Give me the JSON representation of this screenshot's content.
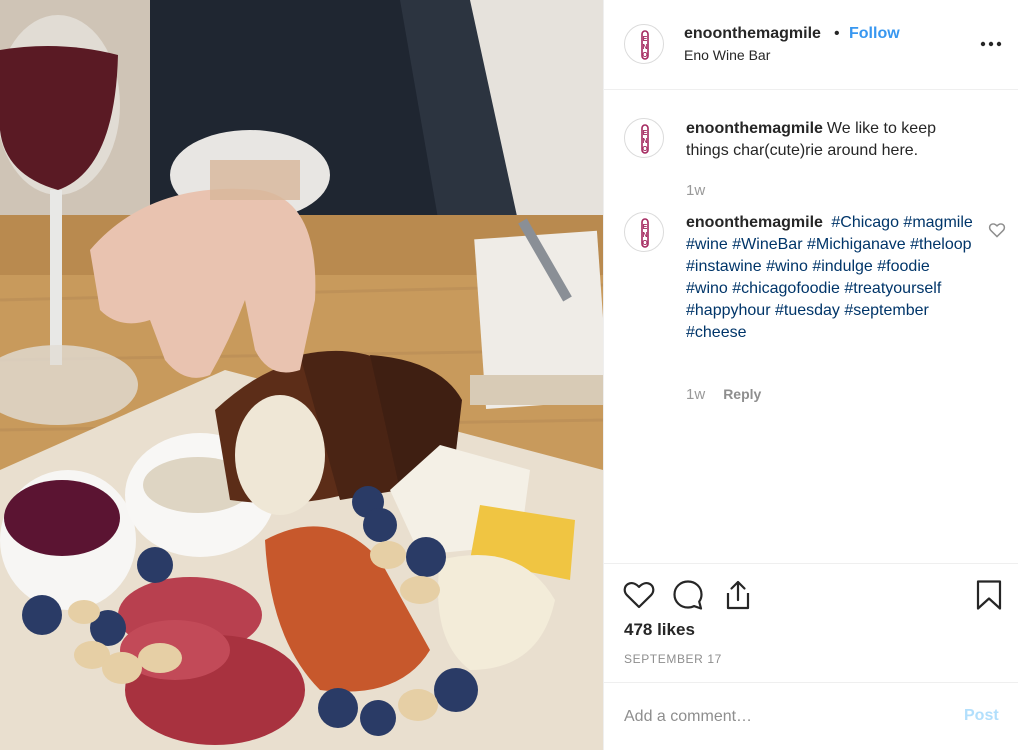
{
  "post": {
    "photo_icon": "charcuterie-photo",
    "header": {
      "username": "enoonthemagmile",
      "separator": "•",
      "follow_label": "Follow",
      "location": "Eno Wine Bar",
      "more_icon": "more-horizontal-icon"
    },
    "avatar_text": "ENO",
    "caption": {
      "username": "enoonthemagmile",
      "text": "We like to keep things char(cute)rie around here.",
      "time": "1w"
    },
    "comment": {
      "username": "enoonthemagmile",
      "tags": [
        "#Chicago",
        "#magmile",
        "#wine",
        "#WineBar",
        "#Michiganave",
        "#theloop",
        "#instawine",
        "#wino",
        "#indulge",
        "#foodie",
        "#wino",
        "#chicagofoodie",
        "#treatyourself",
        "#happyhour",
        "#tuesday",
        "#september",
        "#cheese"
      ],
      "time": "1w",
      "reply_label": "Reply",
      "like_icon": "heart-outline-icon"
    },
    "actions": {
      "like_icon": "heart-icon",
      "comment_icon": "comment-bubble-icon",
      "share_icon": "share-icon",
      "save_icon": "bookmark-icon"
    },
    "likes": "478 likes",
    "date": "SEPTEMBER 17",
    "add_comment": {
      "placeholder": "Add a comment…",
      "post_label": "Post"
    },
    "colors": {
      "link_blue": "#3897f0",
      "hashtag": "#003569",
      "brand_magenta": "#a4285f",
      "post_disabled": "#b2dffc"
    }
  }
}
